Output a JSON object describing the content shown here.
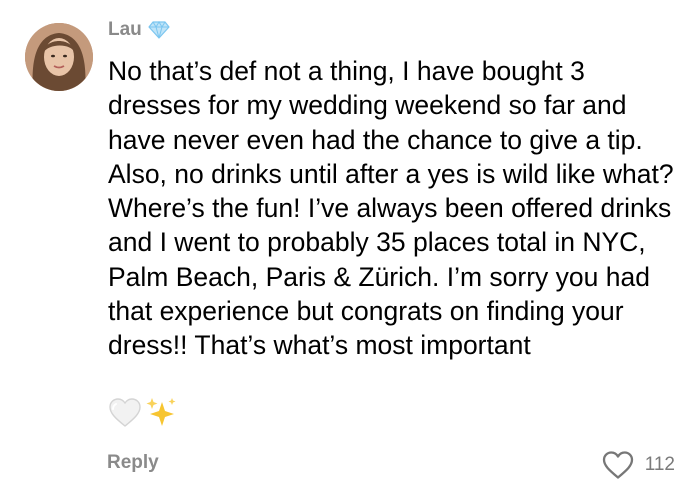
{
  "comment": {
    "username": "Lau",
    "badge_icon": "diamond-icon",
    "body": "No that’s def not a thing, I have bought 3 dresses for my wedding weekend so far and have never even had the chance to give a tip. Also, no drinks until after a yes is wild like what? Where’s the fun! I’ve always been offered drinks and I went to probably 35 places total in NYC, Palm Beach, Paris & Zürich. I’m sorry you had that experience but congrats on finding your dress!! That’s what’s most important",
    "trailing_emojis": [
      "white-heart-icon",
      "sparkles-icon"
    ],
    "reply_label": "Reply",
    "like_icon": "heart-outline-icon",
    "like_count": "112"
  },
  "colors": {
    "meta_text": "#8a8a8a",
    "body_text": "#000000",
    "badge": "#7cc6f0",
    "sparkles": "#f7c531"
  }
}
